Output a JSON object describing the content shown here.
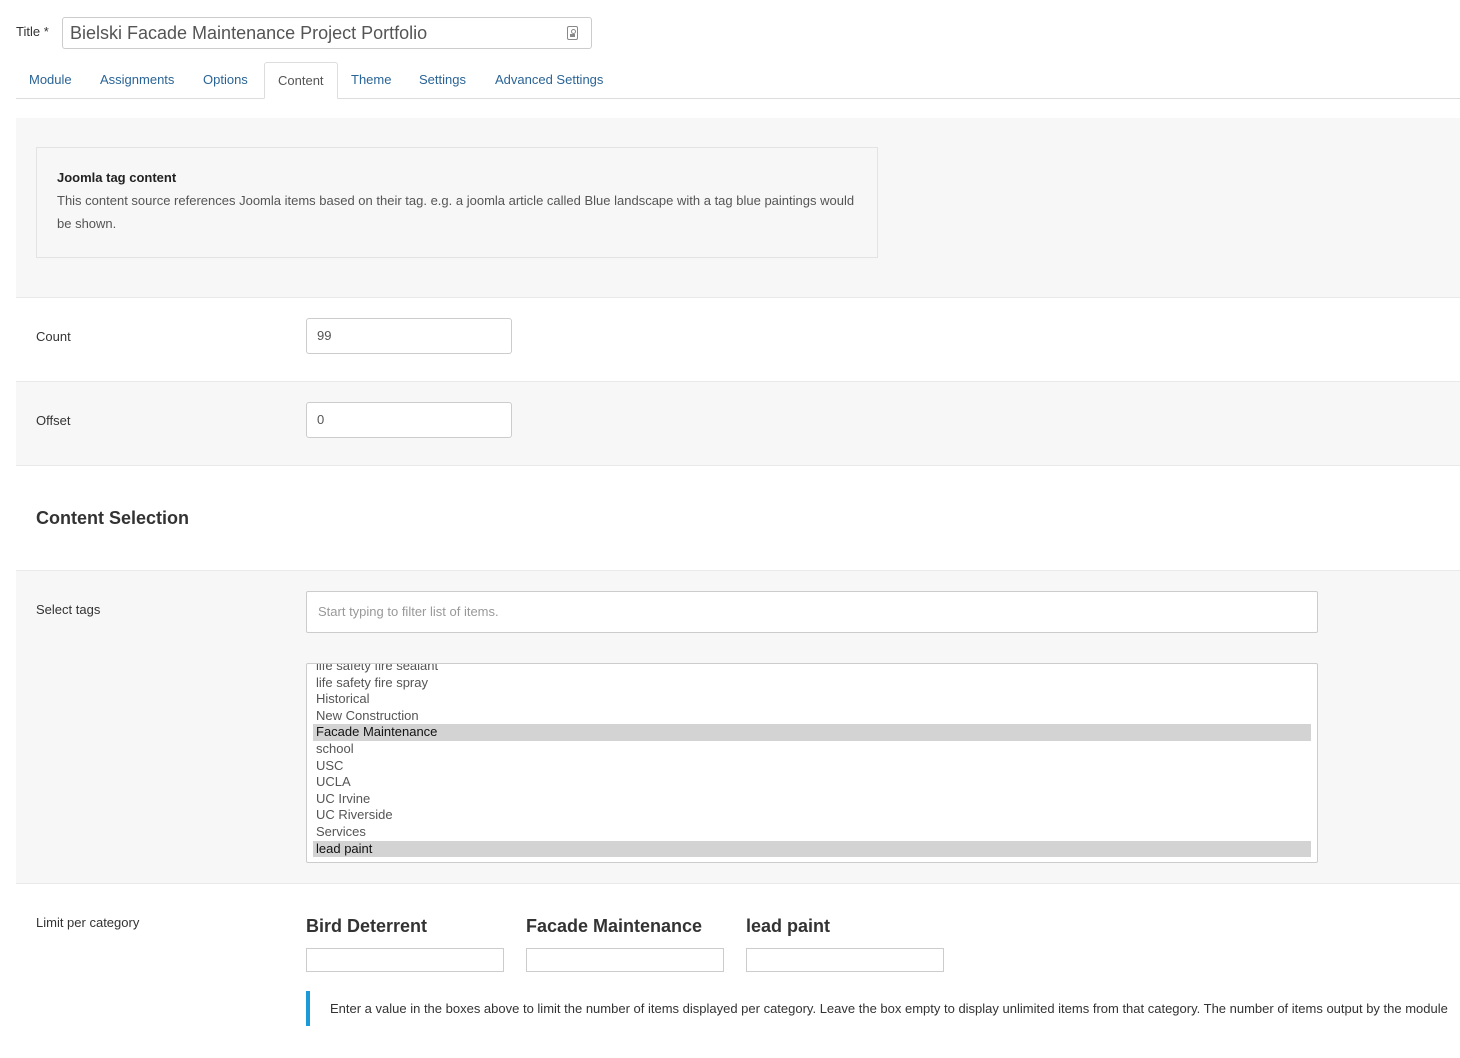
{
  "title": {
    "label": "Title *",
    "value": "Bielski Facade Maintenance Project Portfolio"
  },
  "tabs": [
    {
      "label": "Module"
    },
    {
      "label": "Assignments"
    },
    {
      "label": "Options"
    },
    {
      "label": "Content",
      "active": true
    },
    {
      "label": "Theme"
    },
    {
      "label": "Settings"
    },
    {
      "label": "Advanced Settings"
    }
  ],
  "info": {
    "title": "Joomla tag content",
    "text": "This content source references Joomla items based on their tag. e.g. a joomla article called Blue landscape with a tag blue paintings would be shown."
  },
  "count": {
    "label": "Count",
    "value": "99"
  },
  "offset": {
    "label": "Offset",
    "value": "0"
  },
  "content_selection": {
    "heading": "Content Selection"
  },
  "select_tags": {
    "label": "Select tags",
    "filter_placeholder": "Start typing to filter list of items.",
    "items": [
      {
        "label": "life safety fire sealant",
        "selected": false
      },
      {
        "label": "life safety fire spray",
        "selected": false
      },
      {
        "label": "Historical",
        "selected": false
      },
      {
        "label": "New Construction",
        "selected": false
      },
      {
        "label": "Facade Maintenance",
        "selected": true
      },
      {
        "label": "school",
        "selected": false
      },
      {
        "label": "USC",
        "selected": false
      },
      {
        "label": "UCLA",
        "selected": false
      },
      {
        "label": "UC Irvine",
        "selected": false
      },
      {
        "label": "UC Riverside",
        "selected": false
      },
      {
        "label": "Services",
        "selected": false
      },
      {
        "label": "lead paint",
        "selected": true
      }
    ]
  },
  "limit_per_category": {
    "label": "Limit per category",
    "categories": [
      {
        "name": "Bird Deterrent",
        "value": ""
      },
      {
        "name": "Facade Maintenance",
        "value": ""
      },
      {
        "name": "lead paint",
        "value": ""
      }
    ],
    "note": "Enter a value in the boxes above to limit the number of items displayed per category. Leave the box empty to display unlimited items from that category. The number of items output by the module"
  },
  "colors": {
    "link": "#2a6496",
    "selected_bg": "#d3d3d3",
    "note_accent": "#1a9bd7",
    "panel_bg": "#f7f7f7"
  }
}
